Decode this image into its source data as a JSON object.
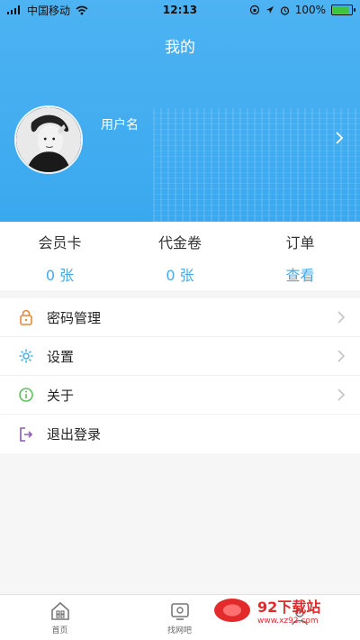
{
  "status_bar": {
    "carrier": "中国移动",
    "time": "12:13",
    "battery": "100%"
  },
  "header": {
    "title": "我的",
    "username": "用户名"
  },
  "stats": [
    {
      "label": "会员卡",
      "value": "0 张"
    },
    {
      "label": "代金卷",
      "value": "0 张"
    },
    {
      "label": "订单",
      "value": "查看"
    }
  ],
  "menu": [
    {
      "label": "密码管理",
      "icon": "lock-icon",
      "color": "#e6883a"
    },
    {
      "label": "设置",
      "icon": "gear-icon",
      "color": "#49b1ea"
    },
    {
      "label": "关于",
      "icon": "info-icon",
      "color": "#5bc25b"
    },
    {
      "label": "退出登录",
      "icon": "logout-icon",
      "color": "#8a5bb0"
    }
  ],
  "tabbar": [
    {
      "label": "首页",
      "icon": "home-icon"
    },
    {
      "label": "找网吧",
      "icon": "find-icon"
    },
    {
      "label": "",
      "icon": "profile-icon"
    }
  ],
  "watermark": {
    "title": "92下载站",
    "url": "www.xz92.com"
  },
  "colors": {
    "hero": "#3aa8ef",
    "accent": "#46a9e8"
  }
}
